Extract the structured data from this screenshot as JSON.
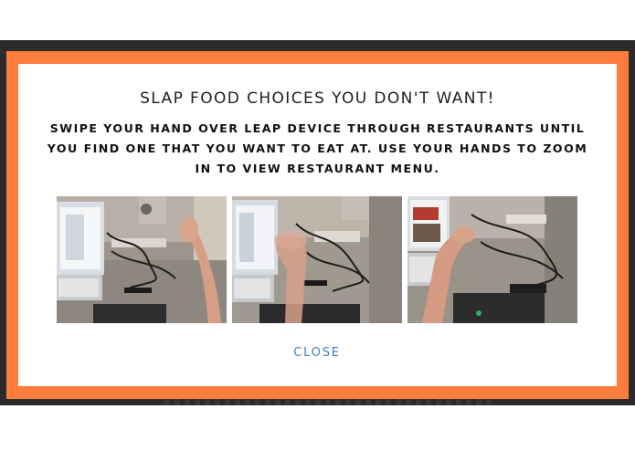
{
  "modal": {
    "title": "SLAP FOOD CHOICES YOU DON'T WANT!",
    "description": "SWIPE YOUR HAND OVER LEAP DEVICE THROUGH RESTAURANTS UNTIL YOU FIND ONE THAT YOU WANT TO EAT AT. USE YOUR HANDS TO ZOOM IN TO VIEW RESTAURANT MENU.",
    "close_label": "CLOSE"
  },
  "colors": {
    "frame": "#ff7d3c",
    "close_link": "#3f7fb9",
    "backdrop": "#2b2b2b"
  }
}
